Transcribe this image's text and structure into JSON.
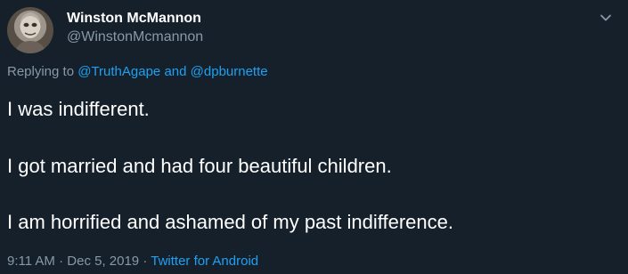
{
  "author": {
    "display_name": "Winston McMannon",
    "handle": "@WinstonMcmannon"
  },
  "reply_context": {
    "prefix": "Replying to",
    "mention_1": "@TruthAgape",
    "conjunction": "and",
    "mention_2": "@dpburnette"
  },
  "tweet_lines": [
    "I was indifferent.",
    "I got married and had four beautiful children.",
    "I am horrified and ashamed of my past indifference."
  ],
  "meta": {
    "time": "9:11 AM",
    "separator_1": "·",
    "date": "Dec 5, 2019",
    "separator_2": "·",
    "source": "Twitter for Android"
  },
  "icons": {
    "avatar": "profile-photo",
    "menu": "chevron-down-icon"
  },
  "colors": {
    "background": "#15202b",
    "primary_text": "#ffffff",
    "secondary_text": "#8899a6",
    "link": "#1da1f2"
  }
}
